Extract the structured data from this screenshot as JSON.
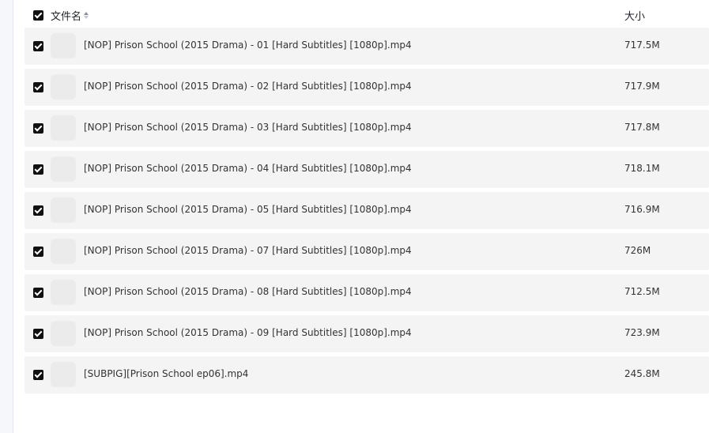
{
  "header": {
    "name_label": "文件名",
    "size_label": "大小"
  },
  "files": [
    {
      "name": "[NOP] Prison School (2015 Drama) - 01 [Hard Subtitles] [1080p].mp4",
      "size": "717.5M",
      "checked": true
    },
    {
      "name": "[NOP] Prison School (2015 Drama) - 02 [Hard Subtitles] [1080p].mp4",
      "size": "717.9M",
      "checked": true
    },
    {
      "name": "[NOP] Prison School (2015 Drama) - 03 [Hard Subtitles] [1080p].mp4",
      "size": "717.8M",
      "checked": true
    },
    {
      "name": "[NOP] Prison School (2015 Drama) - 04 [Hard Subtitles] [1080p].mp4",
      "size": "718.1M",
      "checked": true
    },
    {
      "name": "[NOP] Prison School (2015 Drama) - 05 [Hard Subtitles] [1080p].mp4",
      "size": "716.9M",
      "checked": true
    },
    {
      "name": "[NOP] Prison School (2015 Drama) - 07 [Hard Subtitles] [1080p].mp4",
      "size": "726M",
      "checked": true
    },
    {
      "name": "[NOP] Prison School (2015 Drama) - 08 [Hard Subtitles] [1080p].mp4",
      "size": "712.5M",
      "checked": true
    },
    {
      "name": "[NOP] Prison School (2015 Drama) - 09 [Hard Subtitles] [1080p].mp4",
      "size": "723.9M",
      "checked": true
    },
    {
      "name": "[SUBPIG][Prison School ep06].mp4",
      "size": "245.8M",
      "checked": true
    }
  ]
}
